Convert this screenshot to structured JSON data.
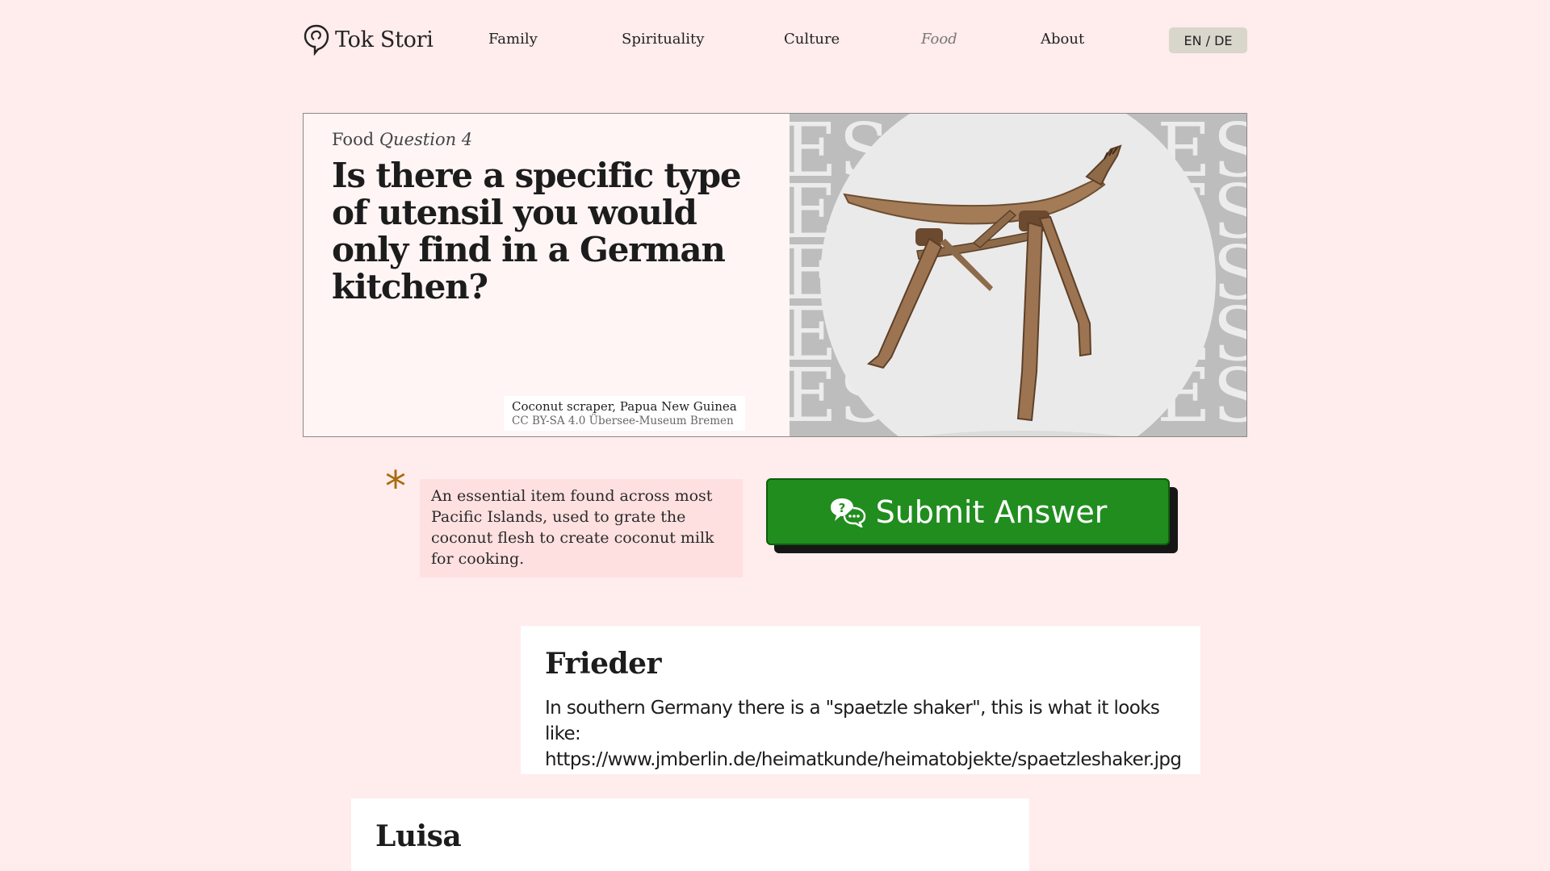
{
  "header": {
    "logo_text": "Tok Stori",
    "nav": [
      "Family",
      "Spirituality",
      "Culture",
      "Food",
      "About"
    ],
    "active_nav": "Food",
    "language_toggle": "EN / DE"
  },
  "hero": {
    "category": "Food",
    "question_number": "Question 4",
    "question": "Is there a specific type of utensil you would only find in a German kitchen?",
    "image_caption": "Coconut scraper, Papua New Guinea",
    "image_credit": "CC BY-SA 4.0 Übersee-Museum Bremen",
    "background_letters": "ES"
  },
  "hint": {
    "text": "An essential item found across most Pacific Islands, used to grate the coconut flesh to create coconut milk for cooking."
  },
  "submit": {
    "label": "Submit Answer",
    "icon": "chat-question-icon"
  },
  "answers": [
    {
      "name": "Frieder",
      "text": "In southern Germany there is a \"spaetzle shaker\", this is what it looks like: https://www.jmberlin.de/heimatkunde/heimatobjekte/spaetzleshaker.jpg"
    },
    {
      "name": "Luisa",
      "text": ""
    }
  ],
  "colors": {
    "page_background": "#ffecec",
    "submit_green": "#218d1f",
    "asterisk": "#a86c10",
    "hint_background": "#ffe0e0"
  }
}
